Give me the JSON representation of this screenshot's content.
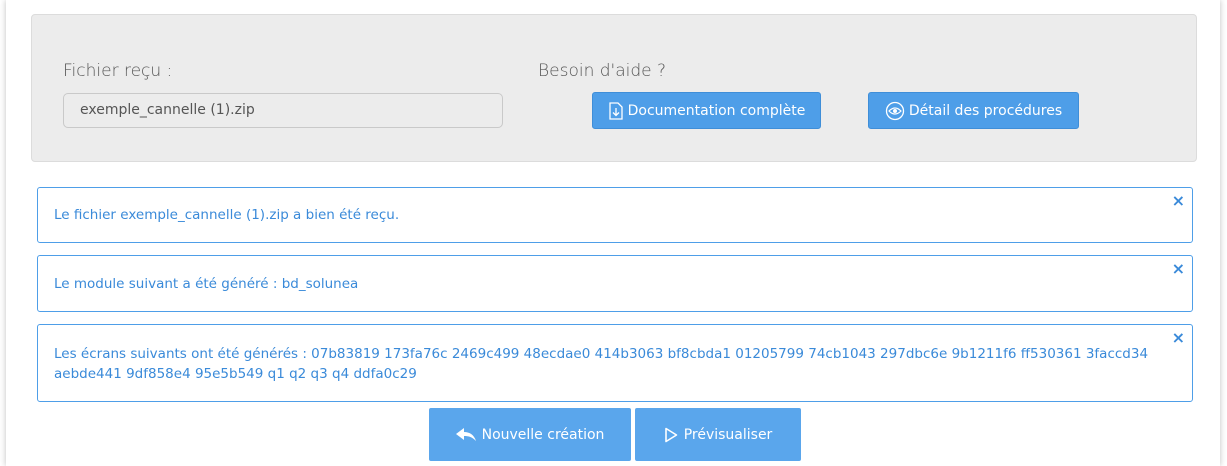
{
  "upload": {
    "file_label": "Fichier reçu :",
    "file_value": "exemple_cannelle (1).zip"
  },
  "help": {
    "label": "Besoin d'aide ?",
    "doc_button": "Documentation complète",
    "doc_icon": "document-download-icon",
    "procedures_button": "Détail des procédures",
    "procedures_icon": "eye-icon"
  },
  "alerts": [
    {
      "text": "Le fichier exemple_cannelle (1).zip a bien été reçu.",
      "close": "×"
    },
    {
      "text": "Le module suivant a été généré : bd_solunea",
      "close": "×"
    },
    {
      "text": "Les écrans suivants ont été générés : 07b83819 173fa76c 2469c499 48ecdae0 414b3063 bf8cbda1 01205799 74cb1043 297dbc6e 9b1211f6 ff530361 3faccd34 aebde441 9df858e4 95e5b549 q1 q2 q3 q4 ddfa0c29",
      "close": "×"
    }
  ],
  "actions": {
    "new_label": "Nouvelle création",
    "new_icon": "reply-arrow-icon",
    "preview_label": "Prévisualiser",
    "preview_icon": "play-outline-icon"
  },
  "colors": {
    "accent": "#4e9ee8",
    "panel_bg": "#ececec",
    "alert_text": "#3a8ad9"
  }
}
